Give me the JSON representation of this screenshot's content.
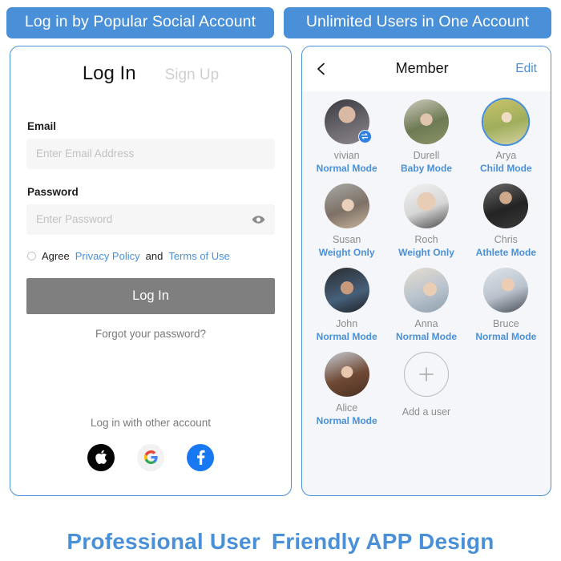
{
  "banners": {
    "left": "Log in by Popular Social Account",
    "right": "Unlimited Users in One Account"
  },
  "login": {
    "tab_active": "Log In",
    "tab_inactive": "Sign Up",
    "email_label": "Email",
    "email_placeholder": "Enter Email Address",
    "email_value": "",
    "password_label": "Password",
    "password_placeholder": "Enter Password",
    "password_value": "",
    "password_toggle_icon": "eye-icon",
    "agree_prefix": "Agree",
    "privacy_link": "Privacy Policy",
    "agree_conjunction": "and",
    "terms_link": "Terms of Use",
    "submit_label": "Log In",
    "forgot_label": "Forgot your password?",
    "other_account_label": "Log in with other account",
    "socials": [
      {
        "name": "apple",
        "icon": "apple-icon"
      },
      {
        "name": "google",
        "icon": "google-icon"
      },
      {
        "name": "facebook",
        "icon": "facebook-icon"
      }
    ]
  },
  "member": {
    "back_icon": "back-chevron-icon",
    "title": "Member",
    "edit_label": "Edit",
    "add_user_label": "Add a user",
    "add_user_icon": "plus-icon",
    "users": [
      {
        "name": "vivian",
        "mode": "Normal Mode",
        "selected": false,
        "badge": "swap-icon"
      },
      {
        "name": "Durell",
        "mode": "Baby Mode",
        "selected": false,
        "badge": ""
      },
      {
        "name": "Arya",
        "mode": "Child Mode",
        "selected": true,
        "badge": ""
      },
      {
        "name": "Susan",
        "mode": "Weight Only",
        "selected": false,
        "badge": ""
      },
      {
        "name": "Roch",
        "mode": "Weight Only",
        "selected": false,
        "badge": ""
      },
      {
        "name": "Chris",
        "mode": "Athlete Mode",
        "selected": false,
        "badge": ""
      },
      {
        "name": "John",
        "mode": "Normal Mode",
        "selected": false,
        "badge": ""
      },
      {
        "name": "Anna",
        "mode": "Normal Mode",
        "selected": false,
        "badge": ""
      },
      {
        "name": "Bruce",
        "mode": "Normal Mode",
        "selected": false,
        "badge": ""
      },
      {
        "name": "Alice",
        "mode": "Normal Mode",
        "selected": false,
        "badge": ""
      }
    ]
  },
  "footer": {
    "left": "Professional User",
    "right": "Friendly APP Design"
  },
  "colors": {
    "accent_blue": "#4a90d9",
    "link_blue": "#4a90d9",
    "button_gray": "#7f7f7f",
    "panel_bg": "#f4f6fa",
    "field_bg": "#f6f6f6"
  }
}
